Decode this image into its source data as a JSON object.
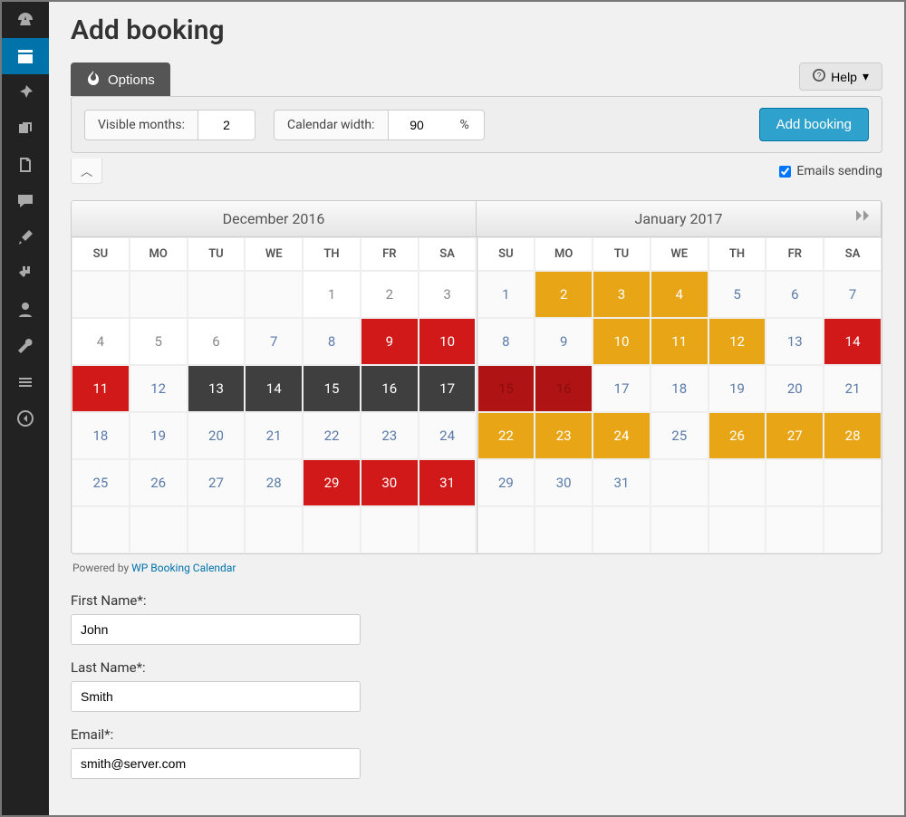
{
  "page": {
    "title": "Add booking"
  },
  "tabs": {
    "options": "Options",
    "help": "Help"
  },
  "options": {
    "visible_months_label": "Visible months:",
    "visible_months_value": "2",
    "calendar_width_label": "Calendar width:",
    "calendar_width_value": "90",
    "calendar_width_unit": "%",
    "add_booking_btn": "Add booking",
    "emails_label": "Emails sending",
    "emails_checked": true
  },
  "calendar": {
    "months": [
      "December 2016",
      "January 2017"
    ],
    "dow": [
      "SU",
      "MO",
      "TU",
      "WE",
      "TH",
      "FR",
      "SA"
    ],
    "dec": [
      [
        {
          "d": ""
        },
        {
          "d": ""
        },
        {
          "d": ""
        },
        {
          "d": ""
        },
        {
          "d": "1",
          "s": "white"
        },
        {
          "d": "2",
          "s": "white"
        },
        {
          "d": "3",
          "s": "white"
        }
      ],
      [
        {
          "d": "4",
          "s": "white"
        },
        {
          "d": "5",
          "s": "white"
        },
        {
          "d": "6",
          "s": "white"
        },
        {
          "d": "7",
          "s": "blue"
        },
        {
          "d": "8",
          "s": "blue"
        },
        {
          "d": "9",
          "s": "red"
        },
        {
          "d": "10",
          "s": "red"
        }
      ],
      [
        {
          "d": "11",
          "s": "red"
        },
        {
          "d": "12",
          "s": "blue"
        },
        {
          "d": "13",
          "s": "dark"
        },
        {
          "d": "14",
          "s": "dark"
        },
        {
          "d": "15",
          "s": "dark"
        },
        {
          "d": "16",
          "s": "dark"
        },
        {
          "d": "17",
          "s": "dark"
        }
      ],
      [
        {
          "d": "18",
          "s": "blue"
        },
        {
          "d": "19",
          "s": "blue"
        },
        {
          "d": "20",
          "s": "blue"
        },
        {
          "d": "21",
          "s": "blue"
        },
        {
          "d": "22",
          "s": "blue"
        },
        {
          "d": "23",
          "s": "blue"
        },
        {
          "d": "24",
          "s": "blue"
        }
      ],
      [
        {
          "d": "25",
          "s": "blue"
        },
        {
          "d": "26",
          "s": "blue"
        },
        {
          "d": "27",
          "s": "blue"
        },
        {
          "d": "28",
          "s": "blue"
        },
        {
          "d": "29",
          "s": "red"
        },
        {
          "d": "30",
          "s": "red"
        },
        {
          "d": "31",
          "s": "red"
        }
      ],
      [
        {
          "d": ""
        },
        {
          "d": ""
        },
        {
          "d": ""
        },
        {
          "d": ""
        },
        {
          "d": ""
        },
        {
          "d": ""
        },
        {
          "d": ""
        }
      ]
    ],
    "jan": [
      [
        {
          "d": "1",
          "s": "blue"
        },
        {
          "d": "2",
          "s": "orange"
        },
        {
          "d": "3",
          "s": "orange"
        },
        {
          "d": "4",
          "s": "orange"
        },
        {
          "d": "5",
          "s": "blue"
        },
        {
          "d": "6",
          "s": "blue"
        },
        {
          "d": "7",
          "s": "blue"
        }
      ],
      [
        {
          "d": "8",
          "s": "blue"
        },
        {
          "d": "9",
          "s": "blue"
        },
        {
          "d": "10",
          "s": "orange"
        },
        {
          "d": "11",
          "s": "orange"
        },
        {
          "d": "12",
          "s": "orange"
        },
        {
          "d": "13",
          "s": "blue"
        },
        {
          "d": "14",
          "s": "red"
        }
      ],
      [
        {
          "d": "15",
          "s": "darkred"
        },
        {
          "d": "16",
          "s": "darkred"
        },
        {
          "d": "17",
          "s": "blue"
        },
        {
          "d": "18",
          "s": "blue"
        },
        {
          "d": "19",
          "s": "blue"
        },
        {
          "d": "20",
          "s": "blue"
        },
        {
          "d": "21",
          "s": "blue"
        }
      ],
      [
        {
          "d": "22",
          "s": "orange"
        },
        {
          "d": "23",
          "s": "orange"
        },
        {
          "d": "24",
          "s": "orange"
        },
        {
          "d": "25",
          "s": "blue"
        },
        {
          "d": "26",
          "s": "orange"
        },
        {
          "d": "27",
          "s": "orange"
        },
        {
          "d": "28",
          "s": "orange"
        }
      ],
      [
        {
          "d": "29",
          "s": "blue"
        },
        {
          "d": "30",
          "s": "blue"
        },
        {
          "d": "31",
          "s": "blue"
        },
        {
          "d": ""
        },
        {
          "d": ""
        },
        {
          "d": ""
        },
        {
          "d": ""
        }
      ],
      [
        {
          "d": ""
        },
        {
          "d": ""
        },
        {
          "d": ""
        },
        {
          "d": ""
        },
        {
          "d": ""
        },
        {
          "d": ""
        },
        {
          "d": ""
        }
      ]
    ]
  },
  "powered": {
    "prefix": "Powered by ",
    "link": "WP Booking Calendar"
  },
  "form": {
    "first_name_label": "First Name*:",
    "first_name_value": "John",
    "last_name_label": "Last Name*:",
    "last_name_value": "Smith",
    "email_label": "Email*:",
    "email_value": "smith@server.com"
  },
  "sidebar": {
    "icons": [
      "dashboard-icon",
      "calendar-icon",
      "pin-icon",
      "media-icon",
      "pages-icon",
      "comments-icon",
      "paintbrush-icon",
      "plugins-icon",
      "users-icon",
      "tools-icon",
      "settings-icon",
      "collapse-icon"
    ]
  }
}
